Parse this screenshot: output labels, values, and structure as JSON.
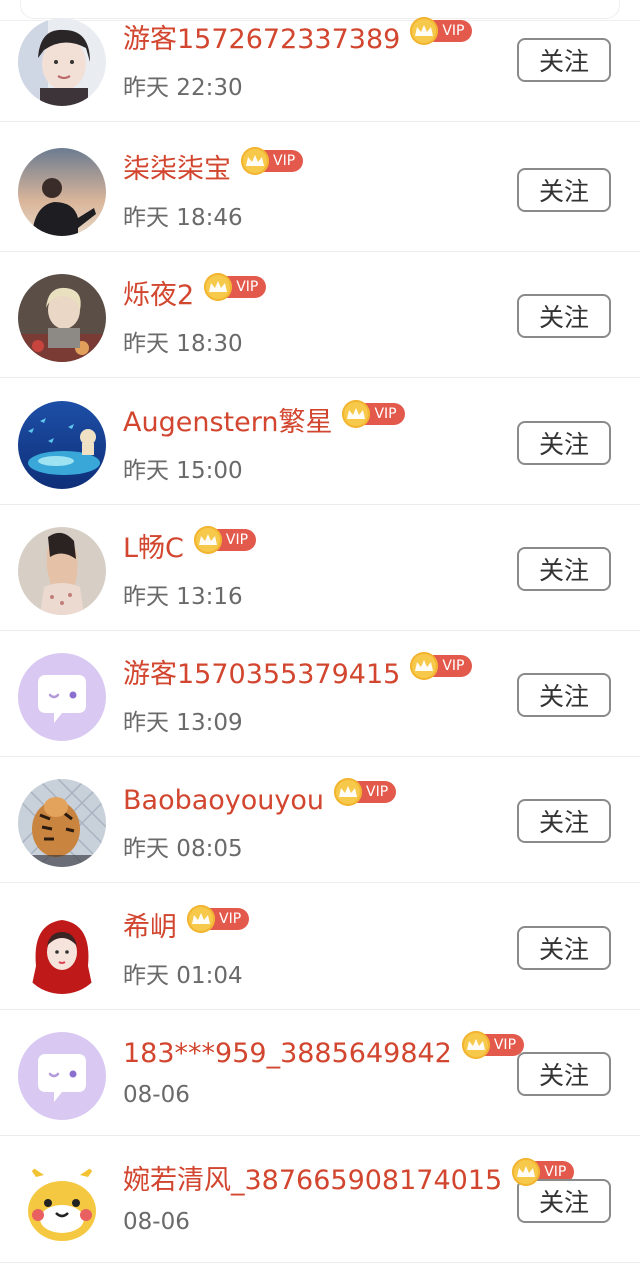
{
  "vip_label": "VIP",
  "follow_label": "关注",
  "users": [
    {
      "name": "游客1572672337389",
      "time": "昨天 22:30",
      "avatar": "photo-portrait"
    },
    {
      "name": "柒柒柒宝",
      "time": "昨天 18:46",
      "avatar": "photo-person-dark"
    },
    {
      "name": "烁夜2",
      "time": "昨天 18:30",
      "avatar": "photo-blond"
    },
    {
      "name": "Augenstern繁星",
      "time": "昨天 15:00",
      "avatar": "photo-ocean"
    },
    {
      "name": "L畅C",
      "time": "昨天 13:16",
      "avatar": "photo-back"
    },
    {
      "name": "游客1570355379415",
      "time": "昨天 13:09",
      "avatar": "default-chat"
    },
    {
      "name": "Baobaoyouyou",
      "time": "昨天 08:05",
      "avatar": "photo-tiger"
    },
    {
      "name": "希岄",
      "time": "昨天 01:04",
      "avatar": "photo-red-hood"
    },
    {
      "name": "183***959_3885649842",
      "time": "08-06",
      "avatar": "default-chat"
    },
    {
      "name": "婉若清风_387665908174015",
      "time": "08-06",
      "avatar": "cartoon-pikachu"
    }
  ],
  "colors": {
    "name": "#d2452e",
    "vip_tag": "#e35a4d",
    "crown": "#f6c94a",
    "default_avatar": "#d9c9f2"
  }
}
